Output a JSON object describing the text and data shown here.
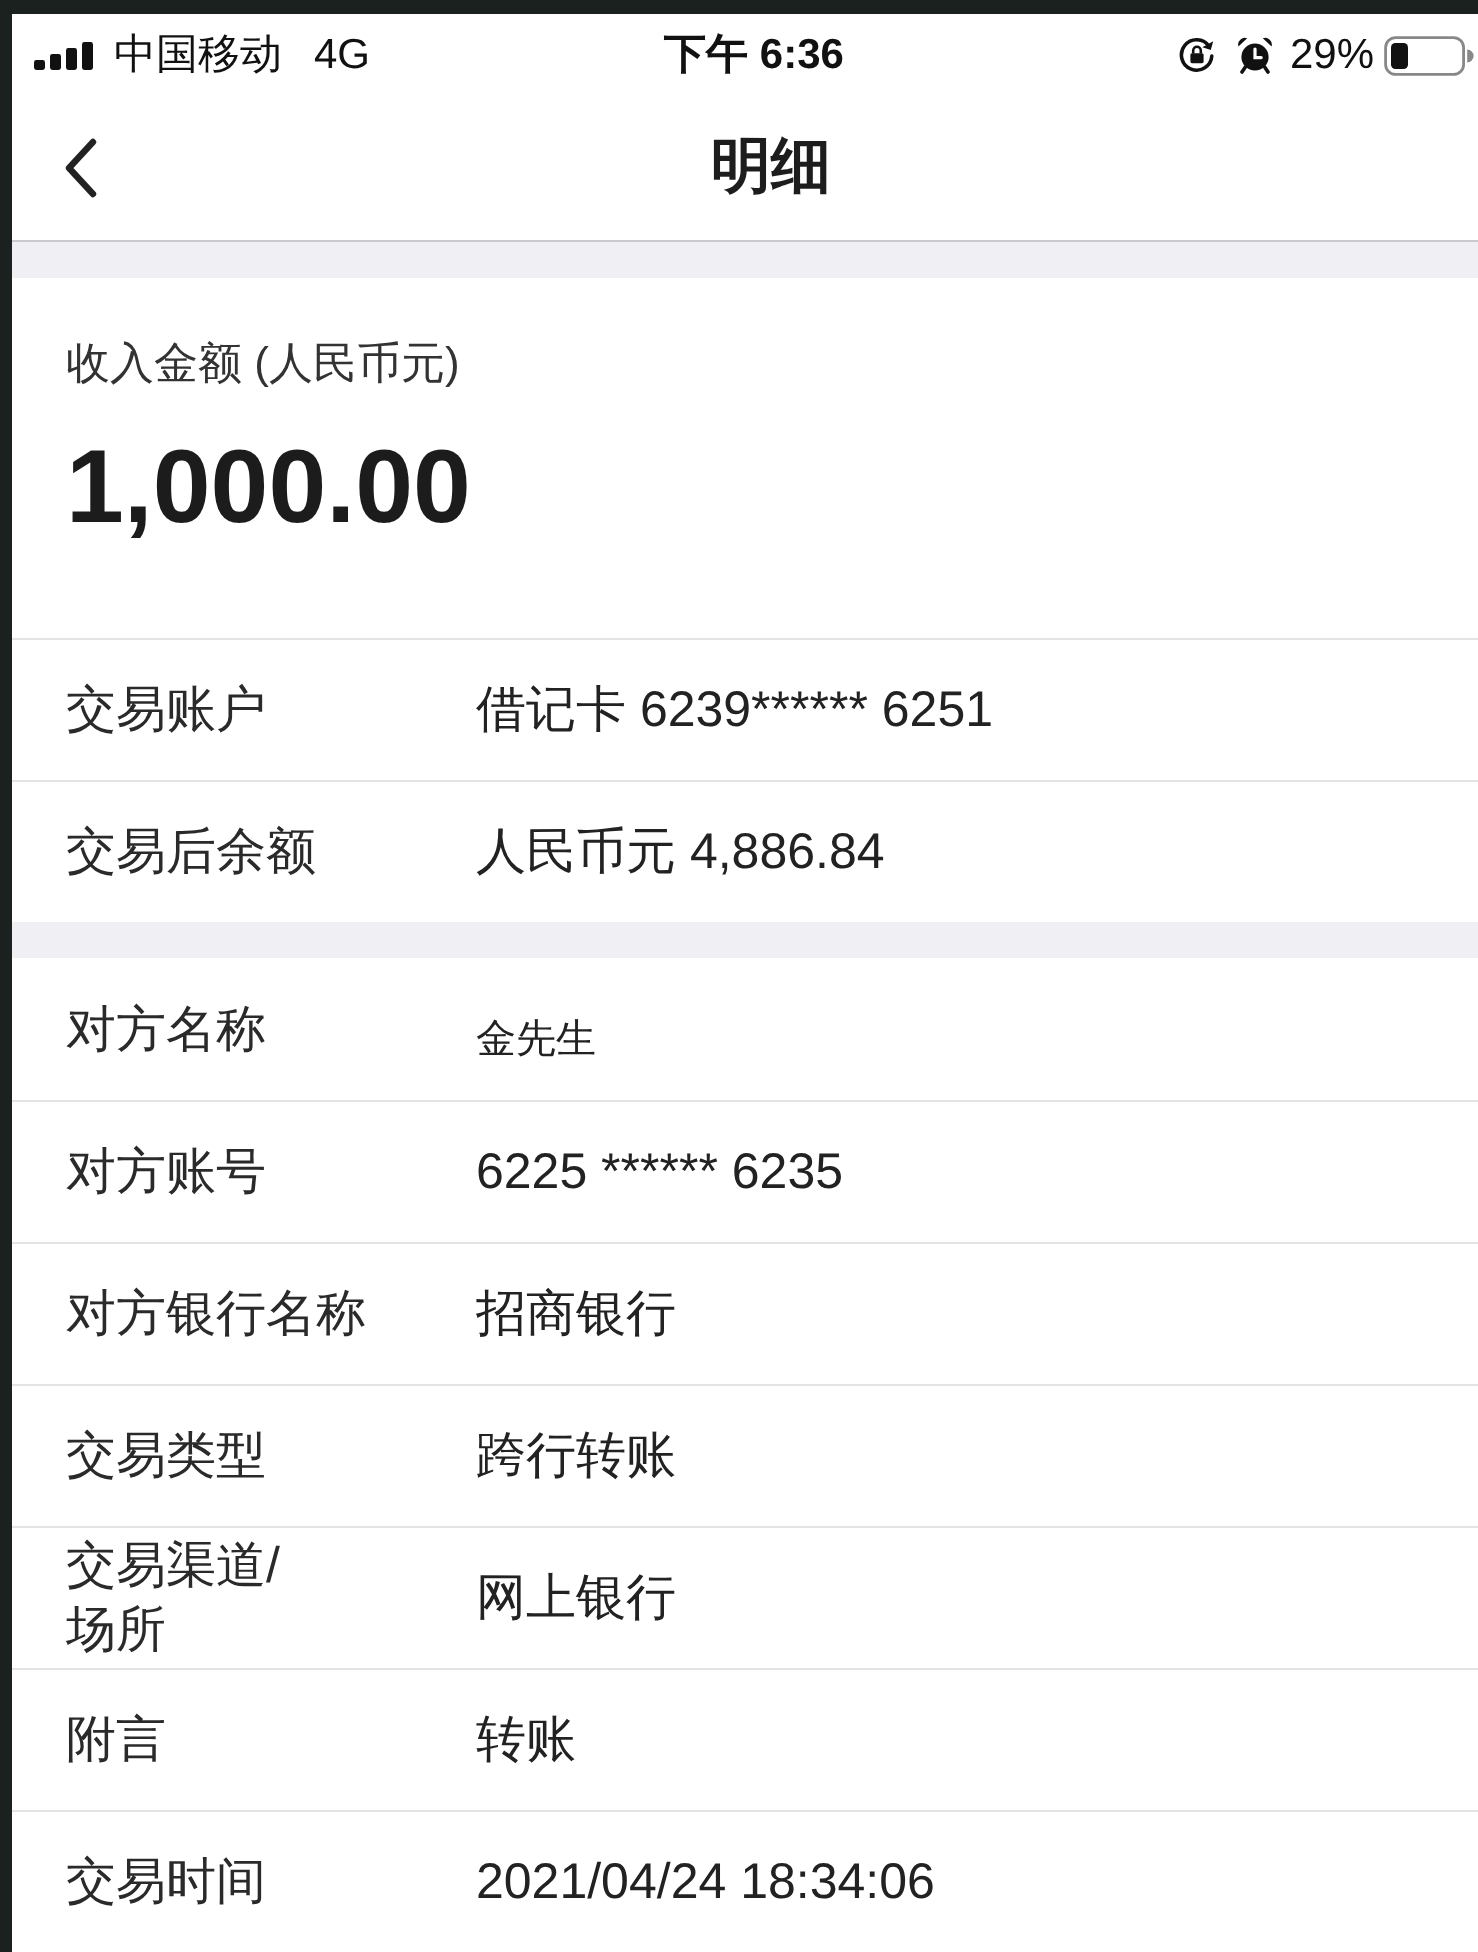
{
  "status_bar": {
    "carrier": "中国移动",
    "network": "4G",
    "time": "下午 6:36",
    "battery": "29%"
  },
  "nav_bar": {
    "title": "明细"
  },
  "sections": [
    {
      "amount": {
        "label": "收入金额 (人民币元)",
        "value": "1,000.00"
      },
      "rows": [
        {
          "kind": "standard",
          "label": "交易账户",
          "value": "借记卡 6239****** 6251"
        },
        {
          "kind": "standard",
          "label": "交易后余额",
          "value": "人民币元 4,886.84"
        }
      ]
    },
    {
      "rows": [
        {
          "kind": "compact",
          "label": "对方名称",
          "value": "金先生"
        },
        {
          "kind": "standard",
          "label": "对方账号",
          "value": "6225 ****** 6235"
        },
        {
          "kind": "standard",
          "label": "对方银行名称",
          "value": "招商银行"
        },
        {
          "kind": "standard",
          "label": "交易类型",
          "value": "跨行转账"
        },
        {
          "kind": "standard",
          "label": "交易渠道/场所",
          "value": "网上银行"
        },
        {
          "kind": "standard",
          "label": "附言",
          "value": "转账"
        },
        {
          "kind": "standard",
          "label": "交易时间",
          "value": "2021/04/24 18:34:06"
        }
      ]
    }
  ]
}
